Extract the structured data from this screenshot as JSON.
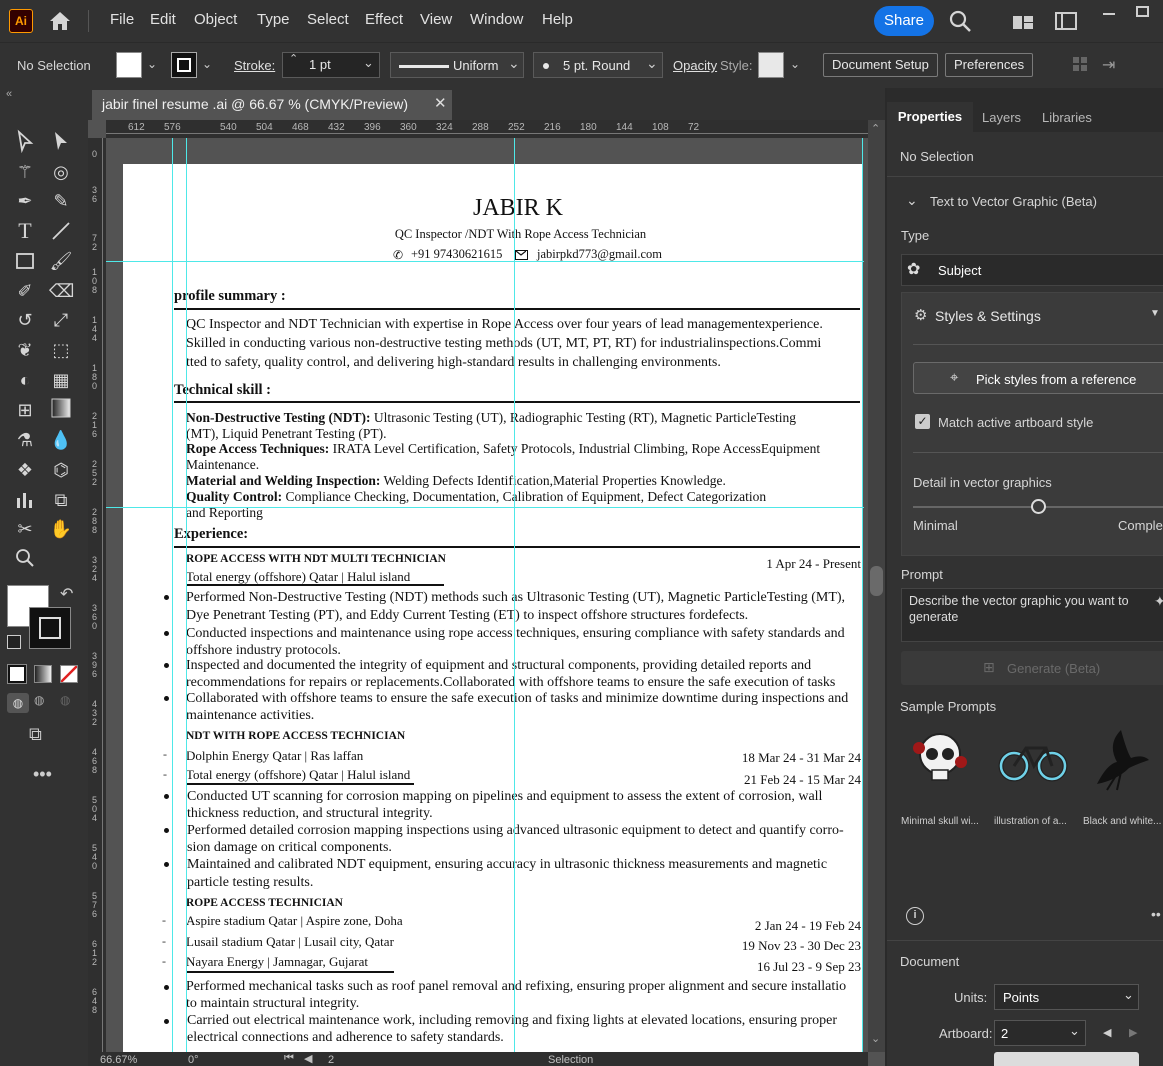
{
  "app": {
    "logo": "Ai",
    "menu": [
      "File",
      "Edit",
      "Object",
      "Type",
      "Select",
      "Effect",
      "View",
      "Window",
      "Help"
    ],
    "share": "Share"
  },
  "control": {
    "selection": "No Selection",
    "stroke_label": "Stroke:",
    "stroke_value": "1 pt",
    "profile": "Uniform",
    "brush": "5 pt. Round",
    "opacity_label": "Opacity",
    "style_label": "Style:",
    "doc_setup": "Document Setup",
    "preferences": "Preferences"
  },
  "tab": {
    "title": "jabir finel resume .ai @ 66.67 % (CMYK/Preview)"
  },
  "ruler": {
    "h": [
      "612",
      "576",
      "540",
      "504",
      "468",
      "432",
      "396",
      "360",
      "324",
      "288",
      "252",
      "216",
      "180",
      "144",
      "108",
      "72"
    ],
    "v": [
      "0",
      "3 6",
      "7 2",
      "1 0 8",
      "1 4 4",
      "1 8 0",
      "2 1 6",
      "2 5 2",
      "2 8 8",
      "3 2 4",
      "3 6 0",
      "3 9 6",
      "4 3 2",
      "4 6 8",
      "5 0 4",
      "5 4 0",
      "5 7 6",
      "6 1 2",
      "6 4 8"
    ]
  },
  "status": {
    "zoom": "66.67%",
    "rotation": "0°",
    "artboard": "2",
    "mode": "Selection"
  },
  "resume": {
    "name": "JABIR K",
    "subtitle": "QC Inspector /NDT With Rope Access Technician",
    "phone": "+91 97430621615",
    "email": "jabirpkd773@gmail.com",
    "h_profile": "profile summary :",
    "profile": [
      "QC Inspector and NDT Technician with expertise in Rope Access over four years of lead managementexperience.",
      "Skilled in conducting various non-destructive testing methods (UT, MT, PT, RT) for industrialinspections.Commi",
      "tted to safety, quality control, and delivering high-standard results in challenging environments."
    ],
    "h_skill": "Technical skill :",
    "skills": [
      {
        "b": "Non-Destructive Testing (NDT):",
        "t": " Ultrasonic Testing (UT), Radiographic Testing (RT), Magnetic ParticleTesting",
        "t2": "(MT), Liquid Penetrant Testing (PT)."
      },
      {
        "b": "Rope Access Techniques:",
        "t": " IRATA Level Certification, Safety Protocols, Industrial Climbing, Rope AccessEquipment",
        "t2": "Maintenance."
      },
      {
        "b": "Material and Welding Inspection:",
        "t": " Welding Defects Identification,Material Properties Knowledge.",
        "t2": ""
      },
      {
        "b": "Quality Control:",
        "t": " Compliance Checking, Documentation, Calibration of Equipment, Defect Categorization",
        "t2": "and Reporting"
      }
    ],
    "h_exp": "Experience:",
    "job1_title": "ROPE ACCESS WITH NDT MULTI TECHNICIAN",
    "job1_date": "1 Apr 24 - Present",
    "job1_company": "Total energy (offshore) Qatar | Halul island",
    "job1_b": [
      [
        "Performed Non-Destructive Testing (NDT) methods such as Ultrasonic Testing (UT), Magnetic ParticleTesting (MT),",
        "Dye Penetrant Testing (PT), and Eddy Current Testing (ET) to inspect offshore structures fordefects."
      ],
      [
        "Conducted inspections and maintenance using rope access techniques, ensuring compliance with safety standards and",
        "offshore industry protocols."
      ],
      [
        "Inspected and documented the integrity of equipment and structural components, providing detailed reports and",
        "recommendations for repairs or replacements.Collaborated with offshore teams to ensure the safe execution of tasks"
      ],
      [
        "Collaborated with offshore teams to ensure the safe execution of tasks and minimize downtime during inspections and",
        "maintenance activities."
      ]
    ],
    "job2_title": "NDT WITH ROPE ACCESS TECHNICIAN",
    "job2_c1": "Dolphin Energy Qatar | Ras laffan",
    "job2_d1": "18 Mar 24 - 31 Mar 24",
    "job2_c2": "Total energy (offshore) Qatar | Halul island",
    "job2_d2": "21 Feb 24 - 15 Mar 24",
    "job2_b": [
      [
        "Conducted UT scanning for corrosion mapping on pipelines and equipment to assess the extent of corrosion, wall",
        "thickness reduction, and structural integrity."
      ],
      [
        "Performed detailed corrosion mapping inspections using advanced ultrasonic equipment to detect and quantify corro-",
        "sion damage on critical components."
      ],
      [
        "Maintained and calibrated NDT equipment, ensuring accuracy in ultrasonic thickness measurements and magnetic",
        "particle testing results."
      ]
    ],
    "job3_title": "ROPE ACCESS TECHNICIAN",
    "job3_c1": "Aspire stadium Qatar | Aspire zone, Doha",
    "job3_d1": "2 Jan 24 - 19 Feb 24",
    "job3_c2": "Lusail stadium Qatar | Lusail city, Qatar",
    "job3_d2": "19 Nov 23 - 30 Dec 23",
    "job3_c3": "Nayara Energy | Jamnagar, Gujarat",
    "job3_d3": "16 Jul 23 - 9 Sep 23",
    "job3_b": [
      [
        "Performed mechanical tasks such as roof panel removal and refixing, ensuring proper alignment and secure installatio",
        "to maintain structural integrity."
      ],
      [
        "Carried out electrical maintenance work, including removing and fixing lights at elevated locations, ensuring proper",
        "electrical connections and adherence to safety standards."
      ]
    ]
  },
  "panel": {
    "tabs": [
      "Properties",
      "Layers",
      "Libraries"
    ],
    "no_selection": "No Selection",
    "t2v": "Text to Vector Graphic (Beta)",
    "type_label": "Type",
    "type_value": "Subject",
    "styles": "Styles & Settings",
    "pick": "Pick styles from a reference",
    "match": "Match active artboard style",
    "detail": "Detail in vector graphics",
    "min": "Minimal",
    "max": "Complex",
    "detail_level": 0.5,
    "prompt_label": "Prompt",
    "prompt_placeholder": "Describe the vector graphic you want to generate",
    "generate": "Generate (Beta)",
    "samples_label": "Sample Prompts",
    "samples": [
      "Minimal skull wi...",
      "illustration of a...",
      "Black and white..."
    ],
    "document": "Document",
    "units_label": "Units:",
    "units": "Points",
    "artboard_label": "Artboard:",
    "artboard": "2"
  },
  "colors": {
    "accent": "#1473e6",
    "guide": "#4ee8e8"
  }
}
